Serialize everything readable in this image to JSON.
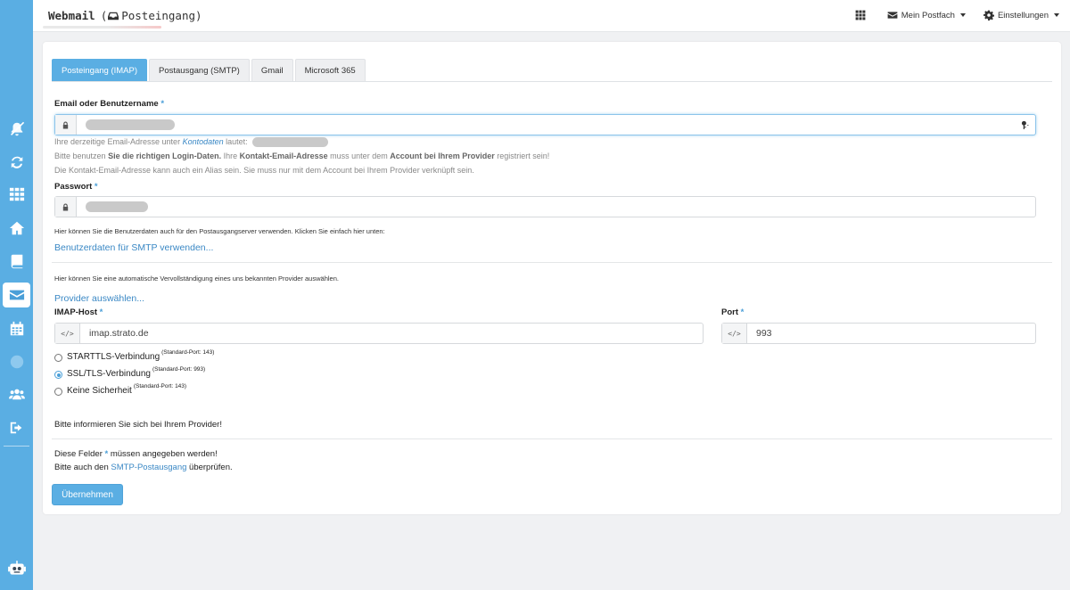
{
  "app": {
    "title_main": "Webmail",
    "title_sub": "Posteingang)",
    "title_open_paren": "("
  },
  "topnav": {
    "apps_icon": "grid-icon",
    "mailbox_label": "Mein Postfach",
    "settings_label": "Einstellungen"
  },
  "sidebar": {
    "items": [
      {
        "icon": "bell-slash-icon"
      },
      {
        "icon": "refresh-icon"
      },
      {
        "icon": "grid-icon"
      },
      {
        "icon": "home-icon"
      },
      {
        "icon": "book-icon"
      },
      {
        "icon": "envelope-icon",
        "active": true
      },
      {
        "icon": "calendar-icon"
      },
      {
        "icon": "globe-icon",
        "faded": true
      },
      {
        "icon": "users-icon"
      },
      {
        "icon": "sign-out-icon"
      },
      {
        "icon": "robot-icon"
      }
    ]
  },
  "tabs": [
    {
      "label": "Posteingang (IMAP)",
      "active": true
    },
    {
      "label": "Postausgang (SMTP)"
    },
    {
      "label": "Gmail"
    },
    {
      "label": "Microsoft 365"
    }
  ],
  "form": {
    "email_label": "Email oder Benutzername",
    "required_mark": "*",
    "email_help_1_pre": "Ihre derzeitige Email-Adresse unter",
    "email_help_1_link": "Kontodaten",
    "email_help_1_post": "lautet:",
    "email_help_2_a": "Bitte benutzen",
    "email_help_2_b": "Sie die richtigen Login-Daten.",
    "email_help_2_c": "Ihre",
    "email_help_2_d": "Kontakt-Email-Adresse",
    "email_help_2_e": "muss unter dem",
    "email_help_2_f": "Account bei Ihrem Provider",
    "email_help_2_g": "registriert sein!",
    "email_help_3": "Die Kontakt-Email-Adresse kann auch ein Alias sein. Sie muss nur mit dem Account bei Ihrem Provider verknüpft sein.",
    "password_label": "Passwort",
    "smtp_help": "Hier können Sie die Benutzerdaten auch für den Postausgangserver verwenden. Klicken Sie einfach hier unten:",
    "smtp_link": "Benutzerdaten für SMTP verwenden...",
    "provider_help": "Hier können Sie eine automatische Vervollständigung eines uns bekannten Provider auswählen.",
    "provider_link": "Provider auswählen...",
    "host_label": "IMAP-Host",
    "host_value": "imap.strato.de",
    "port_label": "Port",
    "port_value": "993",
    "code_addon": "</>",
    "security_options": [
      {
        "label": "STARTTLS-Verbindung",
        "note": "(Standard-Port: 143)",
        "checked": false
      },
      {
        "label": "SSL/TLS-Verbindung",
        "note": "(Standard-Port: 993)",
        "checked": true
      },
      {
        "label": "Keine Sicherheit",
        "note": "(Standard-Port: 143)",
        "checked": false
      }
    ],
    "provider_info": "Bitte informieren Sie sich bei Ihrem Provider!",
    "footer_1_pre": "Diese Felder",
    "footer_1_post": "müssen angegeben werden!",
    "footer_2_pre": "Bitte auch den",
    "footer_2_link": "SMTP-Postausgang",
    "footer_2_post": "überprüfen.",
    "submit_label": "Übernehmen"
  },
  "colors": {
    "accent": "#5aaee3",
    "link": "#3a88c5"
  }
}
